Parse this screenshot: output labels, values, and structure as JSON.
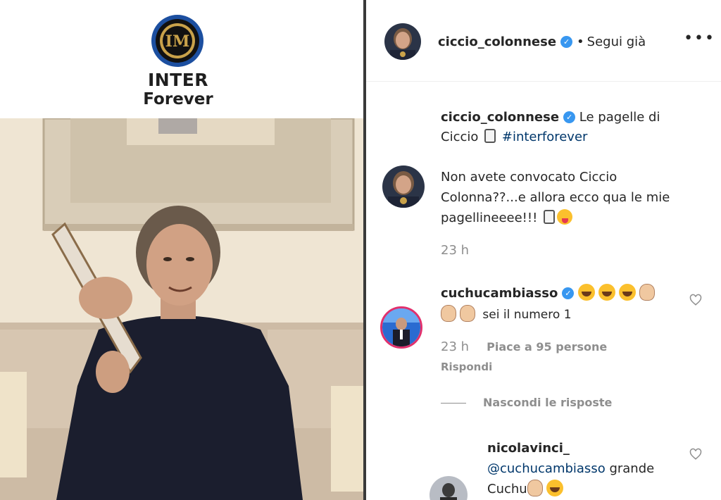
{
  "media": {
    "brand_line1": "INTER",
    "brand_line2": "Forever",
    "logo_icon": "inter-crest-icon",
    "colors": {
      "inter_blue": "#1c4fa0",
      "inter_black": "#111111",
      "inter_gold": "#c9a24a"
    }
  },
  "header": {
    "username": "ciccio_colonnese",
    "follow_separator": "•",
    "follow_label": "Segui già",
    "more_label": "•••"
  },
  "caption": {
    "username": "ciccio_colonnese",
    "text": "Le pagelle di Ciccio",
    "hashtag": "#interforever"
  },
  "post": {
    "text": "Non avete convocato Ciccio Colonna??...e allora ecco qua le mie pagellineeee!!!",
    "time": "23 h"
  },
  "comments": [
    {
      "username": "cuchucambiasso",
      "text": "sei il numero 1",
      "time": "23 h",
      "likes": "Piace a 95 persone",
      "reply_label": "Rispondi"
    }
  ],
  "hide_replies_label": "Nascondi le risposte",
  "reply": {
    "username": "nicolavinci_",
    "mention": "@cuchucambiasso",
    "text_after_mention": "grande",
    "text_line2": "Cuchu"
  },
  "colors": {
    "verified": "#3897f0",
    "link": "#00376b",
    "meta": "#8e8e8e",
    "story_ring": "#e1306c"
  }
}
